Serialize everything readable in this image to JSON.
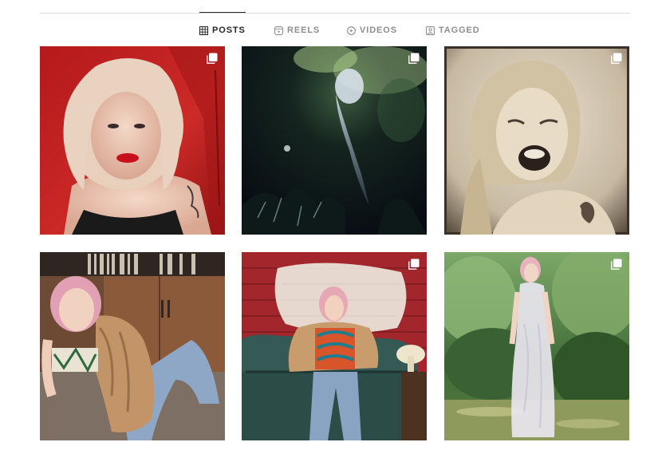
{
  "tabs": [
    {
      "label": "POSTS",
      "icon": "grid-icon",
      "active": true
    },
    {
      "label": "REELS",
      "icon": "reels-icon",
      "active": false
    },
    {
      "label": "VIDEOS",
      "icon": "video-play-icon",
      "active": false
    },
    {
      "label": "TAGGED",
      "icon": "tagged-person-icon",
      "active": false
    }
  ],
  "posts": [
    {
      "subject": "blonde woman, red lips, against red wall",
      "multi": true
    },
    {
      "subject": "ghostly figure among dark foliage",
      "multi": true
    },
    {
      "subject": "sepia portrait with grimace and tattoo",
      "multi": true
    },
    {
      "subject": "pink-haired woman seated with fur coat before record shelf",
      "multi": false
    },
    {
      "subject": "woman on leather sofa before red brick wall",
      "multi": true
    },
    {
      "subject": "woman in sheer dress in garden",
      "multi": true
    }
  ],
  "colors": {
    "active_tab": "#262626",
    "inactive_tab": "#8e8e8e",
    "divider": "#dbdbdb"
  }
}
